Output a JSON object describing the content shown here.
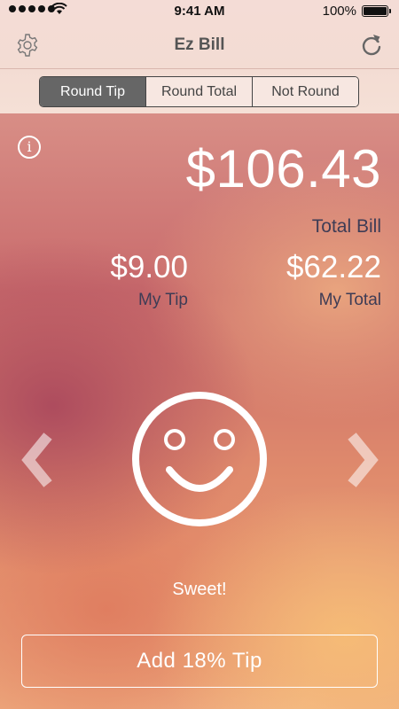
{
  "status_bar": {
    "signal_dots": 5,
    "time": "9:41 AM",
    "battery_percent": "100%",
    "battery_level": 1.0
  },
  "navbar": {
    "title": "Ez Bill",
    "left_icon": "gear-icon",
    "right_icon": "refresh-icon"
  },
  "rounding_modes": {
    "options": [
      "Round Tip",
      "Round Total",
      "Not Round"
    ],
    "selected": "Round Tip"
  },
  "summary": {
    "total_bill_amount": "$106.43",
    "total_bill_label": "Total Bill",
    "my_tip_amount": "$9.00",
    "my_tip_label": "My Tip",
    "my_total_amount": "$62.22",
    "my_total_label": "My Total"
  },
  "tip_selector": {
    "face_icon": "smiley-face-icon",
    "mood_label": "Sweet!",
    "prev_icon": "chevron-left-icon",
    "next_icon": "chevron-right-icon"
  },
  "action": {
    "add_tip_label": "Add 18% Tip"
  },
  "colors": {
    "accent_dark": "#444444",
    "segment_selected_bg": "#666666",
    "label_text": "#3e3c55",
    "amount_text": "#ffffff"
  }
}
